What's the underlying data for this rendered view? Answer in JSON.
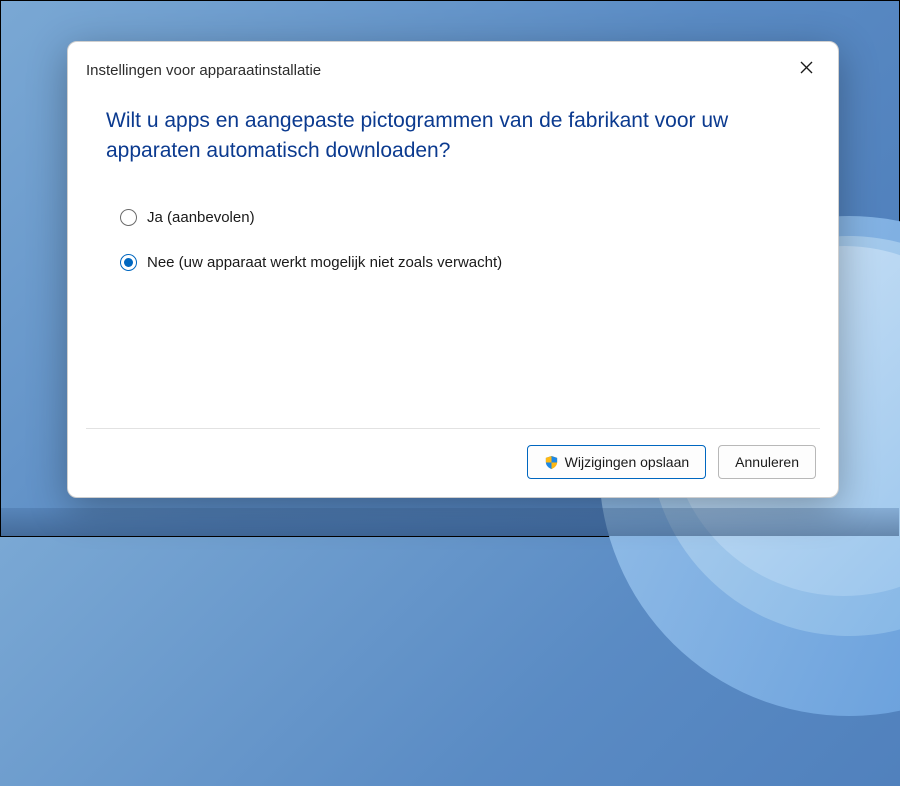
{
  "dialog": {
    "title": "Instellingen voor apparaatinstallatie",
    "question": "Wilt u apps en aangepaste pictogrammen van de fabrikant voor uw apparaten automatisch downloaden?",
    "options": [
      {
        "label": "Ja (aanbevolen)",
        "selected": false
      },
      {
        "label": "Nee (uw apparaat werkt mogelijk niet zoals verwacht)",
        "selected": true
      }
    ],
    "buttons": {
      "save": "Wijzigingen opslaan",
      "cancel": "Annuleren"
    }
  }
}
